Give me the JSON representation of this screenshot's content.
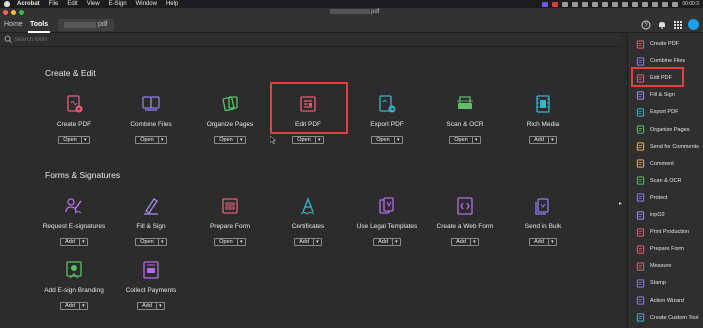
{
  "menubar": {
    "app": "Acrobat",
    "items": [
      "File",
      "Edit",
      "View",
      "E-Sign",
      "Window",
      "Help"
    ],
    "clock": "00:00:3"
  },
  "window": {
    "title_suffix": "pdf"
  },
  "tabs": {
    "home": "Home",
    "tools": "Tools",
    "doc_suffix": "pdf"
  },
  "search": {
    "placeholder": "Search tools"
  },
  "sections": {
    "create_edit": "Create & Edit",
    "forms_signatures": "Forms & Signatures"
  },
  "tools_create_edit": [
    {
      "label": "Create PDF",
      "button": "Open",
      "icon": "create-pdf-icon",
      "color": "#e85c7a"
    },
    {
      "label": "Combine Files",
      "button": "Open",
      "icon": "combine-files-icon",
      "color": "#8e7cf0"
    },
    {
      "label": "Organize Pages",
      "button": "Open",
      "icon": "organize-pages-icon",
      "color": "#5fbd6b"
    },
    {
      "label": "Edit PDF",
      "button": "Open",
      "icon": "edit-pdf-icon",
      "color": "#e85c7a"
    },
    {
      "label": "Export PDF",
      "button": "Open",
      "icon": "export-pdf-icon",
      "color": "#35b6c9"
    },
    {
      "label": "Scan & OCR",
      "button": "Open",
      "icon": "scan-ocr-icon",
      "color": "#5fbd6b"
    },
    {
      "label": "Rich Media",
      "button": "Add",
      "icon": "rich-media-icon",
      "color": "#35b6c9"
    }
  ],
  "tools_forms": [
    {
      "label": "Request E-signatures",
      "button": "Add",
      "icon": "request-esignatures-icon",
      "color": "#b46ee8"
    },
    {
      "label": "Fill & Sign",
      "button": "Open",
      "icon": "fill-sign-icon",
      "color": "#a48cf0"
    },
    {
      "label": "Prepare Form",
      "button": "Open",
      "icon": "prepare-form-icon",
      "color": "#e85c7a"
    },
    {
      "label": "Certificates",
      "button": "Add",
      "icon": "certificates-icon",
      "color": "#35b6c9"
    },
    {
      "label": "Use Legal Templates",
      "button": "Add",
      "icon": "legal-templates-icon",
      "color": "#b46ee8"
    },
    {
      "label": "Create a Web Form",
      "button": "Add",
      "icon": "web-form-icon",
      "color": "#b46ee8"
    },
    {
      "label": "Send in Bulk",
      "button": "Add",
      "icon": "send-bulk-icon",
      "color": "#8e7cf0"
    },
    {
      "label": "Add E-sign Branding",
      "button": "Add",
      "icon": "esign-branding-icon",
      "color": "#5fbd6b"
    },
    {
      "label": "Collect Payments",
      "button": "Add",
      "icon": "collect-payments-icon",
      "color": "#b46ee8"
    }
  ],
  "right_panel": [
    {
      "label": "Create PDF",
      "color": "#e85c7a"
    },
    {
      "label": "Combine Files",
      "color": "#8e7cf0"
    },
    {
      "label": "Edit PDF",
      "color": "#e85c7a"
    },
    {
      "label": "Fill & Sign",
      "color": "#a48cf0"
    },
    {
      "label": "Export PDF",
      "color": "#35b6c9"
    },
    {
      "label": "Organize Pages",
      "color": "#5fbd6b"
    },
    {
      "label": "Send for Comments",
      "color": "#e8b84a"
    },
    {
      "label": "Comment",
      "color": "#e8b84a"
    },
    {
      "label": "Scan & OCR",
      "color": "#5fbd6b"
    },
    {
      "label": "Protect",
      "color": "#8e7cf0"
    },
    {
      "label": "inpO2",
      "color": "#a48cf0"
    },
    {
      "label": "Print Production",
      "color": "#e85c7a"
    },
    {
      "label": "Prepare Form",
      "color": "#e85c7a"
    },
    {
      "label": "Measure",
      "color": "#e85c7a"
    },
    {
      "label": "Stamp",
      "color": "#8e7cf0"
    },
    {
      "label": "Action Wizard",
      "color": "#8e7cf0"
    },
    {
      "label": "Create Custom Tool",
      "color": "#35b6c9"
    }
  ]
}
